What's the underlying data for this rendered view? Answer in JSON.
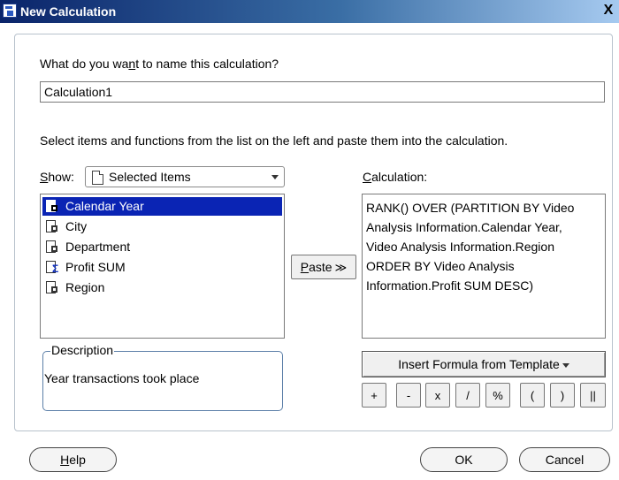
{
  "window": {
    "title": "New Calculation",
    "close_glyph": "X"
  },
  "name_section": {
    "prompt_pre": "What do you wa",
    "prompt_key": "n",
    "prompt_post": "t to name this calculation?",
    "value": "Calculation1"
  },
  "instructions": "Select items and functions from the list on the left and paste them into the calculation.",
  "show": {
    "label_key": "S",
    "label_rest": "how:",
    "selected": "Selected Items"
  },
  "items": [
    {
      "label": "Calendar Year",
      "icon": "dimension-item-icon",
      "selected": true
    },
    {
      "label": "City",
      "icon": "dimension-item-icon",
      "selected": false
    },
    {
      "label": "Department",
      "icon": "dimension-item-icon",
      "selected": false
    },
    {
      "label": "Profit SUM",
      "icon": "measure-sum-icon",
      "selected": false
    },
    {
      "label": "Region",
      "icon": "dimension-item-icon",
      "selected": false
    }
  ],
  "paste_button": {
    "key": "P",
    "rest": "aste",
    "chevron": "≫"
  },
  "calculation": {
    "label_key": "C",
    "label_rest": "alculation:",
    "text": "RANK() OVER (PARTITION BY Video\nAnalysis Information.Calendar Year,\nVideo Analysis Information.Region\nORDER BY Video Analysis\nInformation.Profit SUM DESC)"
  },
  "description": {
    "legend": "Description",
    "text": "Year transactions took place"
  },
  "template_button": "Insert Formula from Template",
  "operators": [
    "+",
    "-",
    "x",
    "/",
    "%",
    "(",
    ")",
    "||"
  ],
  "footer": {
    "help_key": "H",
    "help_rest": "elp",
    "ok": "OK",
    "cancel": "Cancel"
  },
  "colors": {
    "selection": "#0a24b4",
    "title_bar": "#0a246a",
    "frame_border": "#5c7fa8"
  }
}
